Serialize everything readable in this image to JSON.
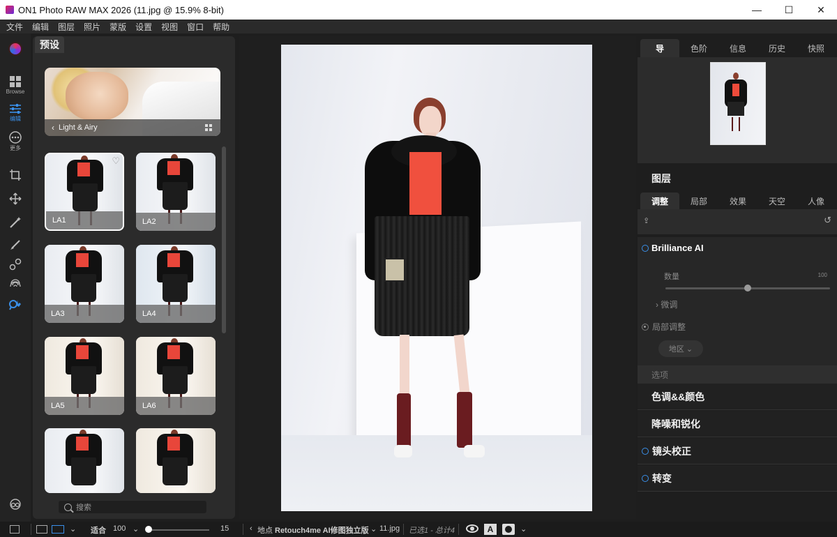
{
  "window": {
    "title": "ON1 Photo RAW MAX 2026 (11.jpg @ 15.9% 8-bit)",
    "minimize": "—",
    "maximize": "☐",
    "close": "✕"
  },
  "menu": [
    "文件",
    "编辑",
    "图层",
    "照片",
    "蒙版",
    "设置",
    "视图",
    "窗口",
    "帮助"
  ],
  "tools": {
    "browse_label": "Browse",
    "edit_label": "编辑",
    "more_label": "更多"
  },
  "presets": {
    "tab_label": "预设",
    "category": "Light & Airy",
    "items": [
      "LA1",
      "LA2",
      "LA3",
      "LA4",
      "LA5",
      "LA6",
      "",
      ""
    ],
    "search_placeholder": "搜索"
  },
  "right": {
    "nav_tabs": [
      "导",
      "色阶",
      "信息",
      "历史",
      "快照"
    ],
    "layers_title": "图层",
    "edit_tabs": [
      "调整",
      "局部",
      "效果",
      "天空",
      "人像"
    ],
    "brilliance": {
      "title": "Brilliance AI",
      "amount_label": "数量",
      "amount_value": "100",
      "amount": 0.5,
      "fine_tune": "微调",
      "local_adjust": "局部调整",
      "region": "地区",
      "options": "选项"
    },
    "sections": [
      "色调&&颜色",
      "降噪和锐化",
      "镜头校正",
      "转变"
    ]
  },
  "status": {
    "fit": "适合",
    "zoom": "100",
    "size_value": "15",
    "location_prefix": "地点",
    "folder": "Retouch4me AI修图独立版",
    "filename": "11.jpg",
    "selection": "已选1 - 总计4"
  },
  "colors": {
    "accent": "#3a8fe8"
  }
}
